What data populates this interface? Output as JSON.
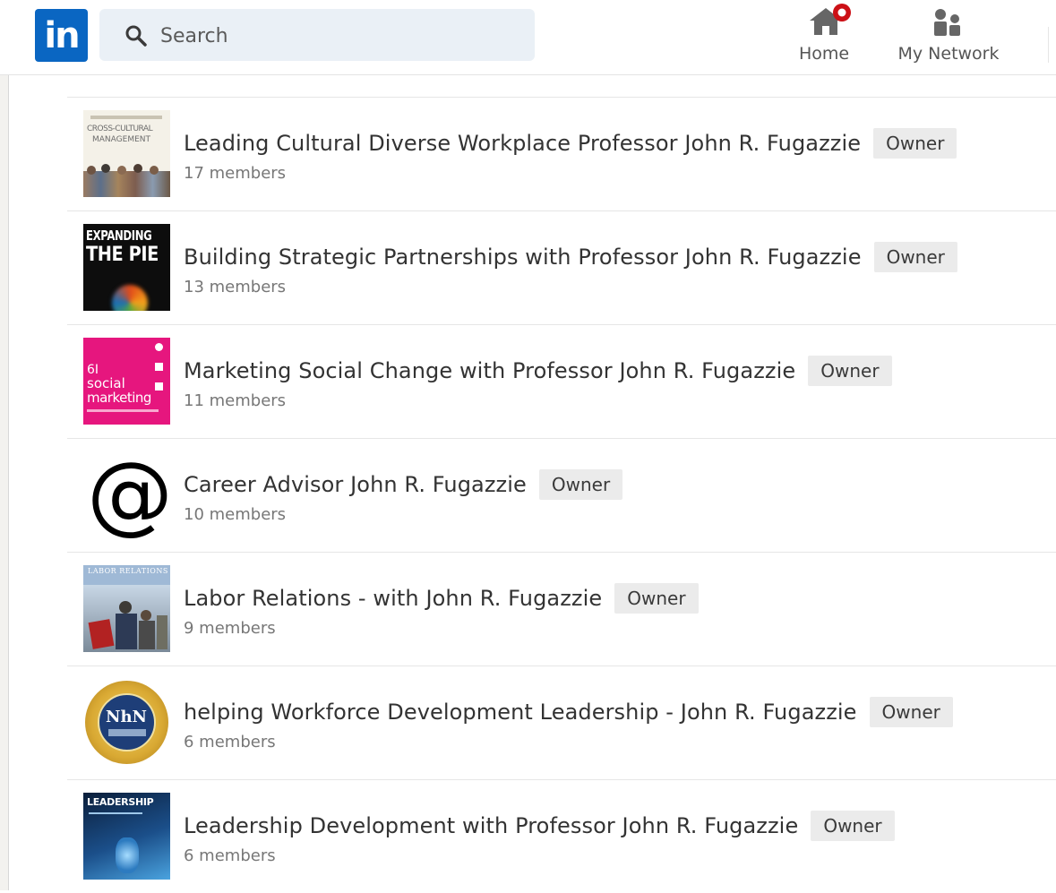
{
  "header": {
    "logo_text": "in",
    "search_placeholder": "Search",
    "nav": {
      "home_label": "Home",
      "network_label": "My Network"
    }
  },
  "groups": [
    {
      "name": "Leading Cultural Diverse Workplace Professor John R. Fugazzie",
      "badge": "Owner",
      "members": "17 members"
    },
    {
      "name": "Building Strategic Partnerships with Professor John R. Fugazzie",
      "badge": "Owner",
      "members": "13 members"
    },
    {
      "name": "Marketing Social Change with Professor John R. Fugazzie",
      "badge": "Owner",
      "members": "11 members"
    },
    {
      "name": "Career Advisor John R. Fugazzie",
      "badge": "Owner",
      "members": "10 members"
    },
    {
      "name": "Labor Relations - with John R. Fugazzie",
      "badge": "Owner",
      "members": "9 members"
    },
    {
      "name": "helping Workforce Development Leadership - John R. Fugazzie",
      "badge": "Owner",
      "members": "6 members"
    },
    {
      "name": "Leadership Development with Professor John R. Fugazzie",
      "badge": "Owner",
      "members": "6 members"
    }
  ],
  "thumb_text": {
    "cross_cultural_title": "CROSS-CULTURAL",
    "cross_cultural_subtitle": "MANAGEMENT",
    "pie_line1": "EXPANDING",
    "pie_line2": "THE PIE",
    "social_line1": "6I",
    "social_line2": "social",
    "social_line3": "marketing",
    "at_symbol": "@",
    "labor_title": "LABOR RELATIONS",
    "seal_text": "NhN",
    "leadership_title": "LEADERSHIP"
  },
  "colors": {
    "linkedin_blue": "#0a66c2",
    "notification_red": "#cc1016",
    "badge_bg": "#ebebeb",
    "social_pink": "#e6167e"
  }
}
